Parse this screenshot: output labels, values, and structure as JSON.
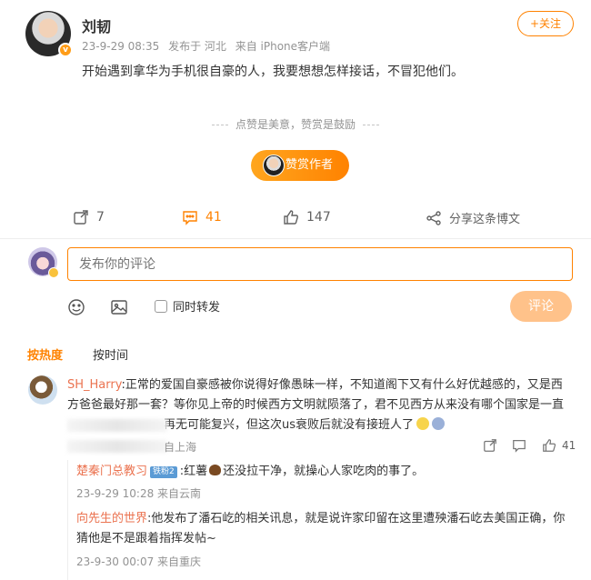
{
  "post": {
    "author": "刘韧",
    "time": "23-9-29 08:35",
    "location": "发布于 河北",
    "source": "来自 iPhone客户端",
    "follow_label": "+关注",
    "text": "开始遇到拿华为手机很自豪的人，我要想想怎样接话，不冒犯他们。",
    "reward_tip": "点赞是美意，赞赏是鼓励",
    "reward_button": "赞赏作者"
  },
  "actions": {
    "repost_count": "7",
    "comment_count": "41",
    "like_count": "147",
    "share_label": "分享这条博文"
  },
  "comment_box": {
    "placeholder": "发布你的评论",
    "repost_label": "同时转发",
    "submit_label": "评论"
  },
  "sort": {
    "hot": "按热度",
    "time": "按时间"
  },
  "comments": [
    {
      "username": "SH_Harry",
      "text_line1": ":正常的爱国自豪感被你说得好像愚昧一样，不知道阁下又有什么好优越感的，又是西",
      "text_line2": "方爸爸最好那一套？等你见上帝的时候西方文明就陨落了，君不见西方从来没有哪个国家是一直",
      "text_line3": "再无可能复兴，但这次us衰败后就没有接班人了",
      "location": "自上海",
      "like_count": "41"
    }
  ],
  "replies": [
    {
      "username": "楚秦门总教习",
      "badge": "铁粉2",
      "text": ":红薯",
      "text_after": "还没拉干净，就操心人家吃肉的事了。",
      "meta": "23-9-29 10:28 来自云南"
    },
    {
      "username": "向先生的世界",
      "text_line1": ":他发布了潘石屹的相关讯息，就是说许家印留在这里遭殃潘石屹去美国正确，你",
      "text_line2": "猜他是不是跟着指挥发帖~",
      "meta": "23-9-30 00:07 来自重庆"
    }
  ],
  "colors": {
    "accent": "#ff8200",
    "username": "#eb7350"
  }
}
